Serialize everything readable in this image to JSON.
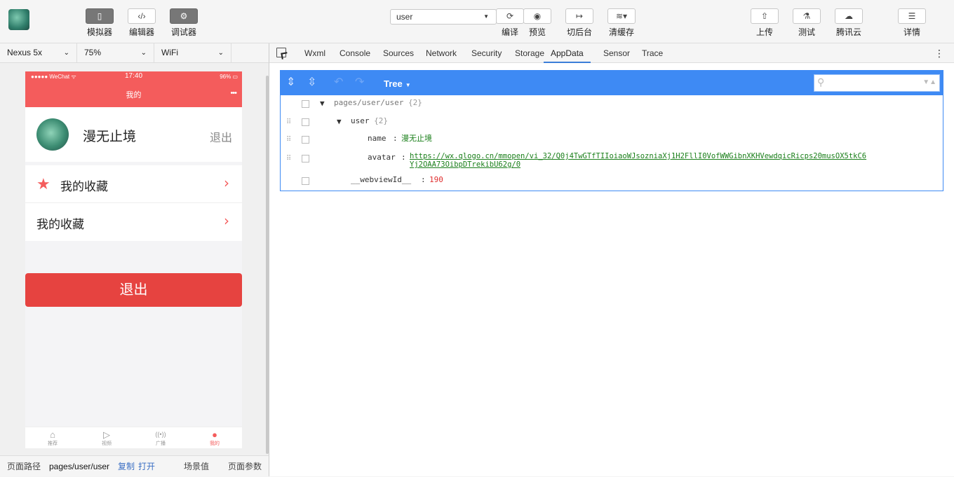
{
  "toolbar": {
    "simulator": "模拟器",
    "editor": "编辑器",
    "debugger": "调试器",
    "page_select": "user",
    "compile": "编译",
    "preview": "预览",
    "background": "切后台",
    "clear_cache": "清缓存",
    "upload": "上传",
    "test": "测试",
    "tencent_cloud": "腾讯云",
    "details": "详情"
  },
  "device": {
    "model": "Nexus 5x",
    "zoom": "75%",
    "network": "WiFi"
  },
  "phone": {
    "signal": "●●●●● WeChat ᯤ",
    "time": "17:40",
    "battery": "96% ▭",
    "nav_title": "我的",
    "nav_more": "•••",
    "username": "漫无止境",
    "logout_link": "退出",
    "cells": [
      {
        "label": "我的收藏"
      },
      {
        "label": "我的收藏"
      }
    ],
    "logout_button": "退出",
    "tabs": [
      {
        "label": "推荐",
        "icon": "⌂"
      },
      {
        "label": "视频",
        "icon": "▷"
      },
      {
        "label": "广播",
        "icon": "((•))"
      },
      {
        "label": "我的",
        "icon": "●"
      }
    ]
  },
  "bottombar": {
    "path_label": "页面路径",
    "path": "pages/user/user",
    "copy": "复制",
    "open": "打开",
    "scene": "场景值",
    "params": "页面参数"
  },
  "devtools": {
    "tabs": [
      "Wxml",
      "Console",
      "Sources",
      "Network",
      "Security",
      "Storage",
      "AppData",
      "Sensor",
      "Trace"
    ],
    "active_tab": "AppData",
    "tree_mode": "Tree",
    "tree": {
      "root_key": "pages/user/user",
      "root_meta": "{2}",
      "user_key": "user",
      "user_meta": "{2}",
      "name_key": "name",
      "name_value": "漫无止境",
      "avatar_key": "avatar",
      "avatar_value_line1": "https://wx.qlogo.cn/mmopen/vi_32/Q0j4TwGTfTIIoiaoWJsozniaXj1H2FllI0VofWWGibnXKHVewdqicRicps20musOX5tkC6",
      "avatar_value_line2": "Yj2OAA73OibpDTrekibU62g/0",
      "webview_key": "__webviewId__",
      "webview_value": "190"
    }
  },
  "colors": {
    "nav_red": "#f45c5c",
    "button_red": "#e64340",
    "tree_blue": "#3e8af4",
    "string_green": "#1a7f1a",
    "number_red": "#e03030"
  }
}
